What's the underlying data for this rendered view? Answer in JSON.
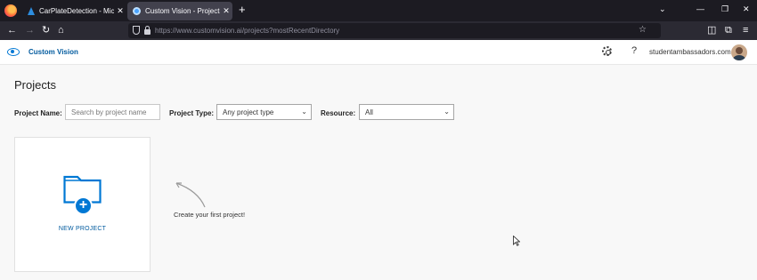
{
  "browser": {
    "tabs": [
      {
        "title": "CarPlateDetection - Microsoft A",
        "active": false
      },
      {
        "title": "Custom Vision - Projects",
        "active": true
      }
    ],
    "new_tab_symbol": "+",
    "url": "https://www.customvision.ai/projects?mostRecentDirectory"
  },
  "header": {
    "brand": "Custom Vision",
    "account": "studentambassadors.com",
    "help_symbol": "?"
  },
  "main": {
    "title": "Projects",
    "filters": {
      "name_label": "Project Name:",
      "name_placeholder": "Search by project name",
      "type_label": "Project Type:",
      "type_value": "Any project type",
      "resource_label": "Resource:",
      "resource_value": "All"
    },
    "new_project_label": "NEW PROJECT",
    "hint": "Create your first project!"
  },
  "colors": {
    "accent": "#0078d4",
    "brand_text": "#005a9e",
    "browser_dark": "#1c1b22",
    "browser_nav": "#2b2a33"
  }
}
